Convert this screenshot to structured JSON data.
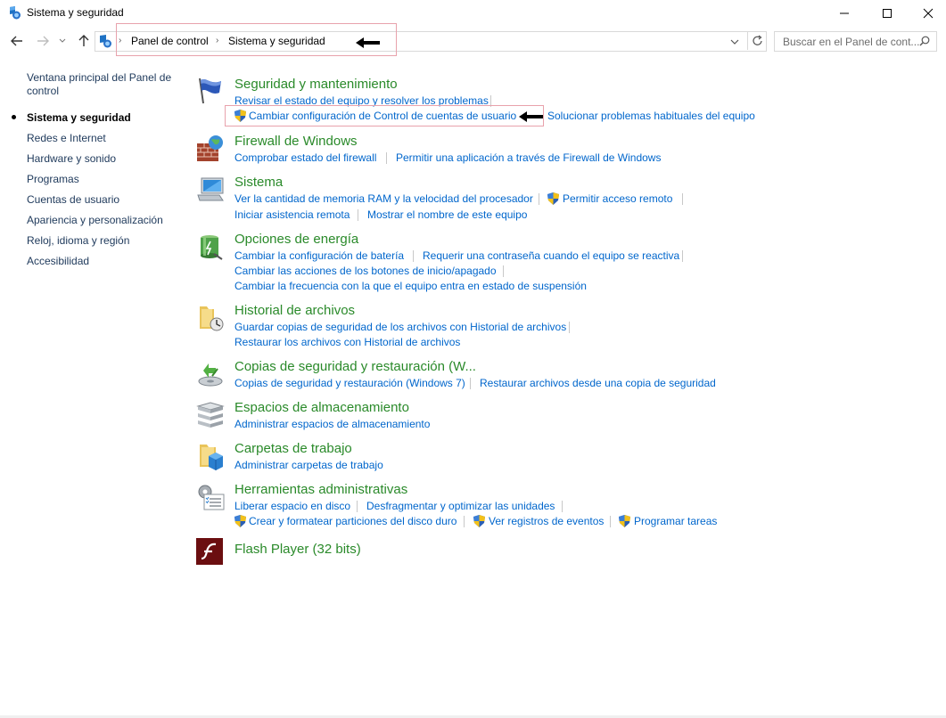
{
  "window": {
    "title": "Sistema y seguridad"
  },
  "nav": {
    "breadcrumb_root": "Panel de control",
    "breadcrumb_current": "Sistema y seguridad",
    "search_placeholder": "Buscar en el Panel de cont..."
  },
  "sidebar": {
    "home_line1": "Ventana principal del Panel de",
    "home_line2": "control",
    "items": [
      {
        "label": "Sistema y seguridad"
      },
      {
        "label": "Redes e Internet"
      },
      {
        "label": "Hardware y sonido"
      },
      {
        "label": "Programas"
      },
      {
        "label": "Cuentas de usuario"
      },
      {
        "label": "Apariencia y personalización"
      },
      {
        "label": "Reloj, idioma y región"
      },
      {
        "label": "Accesibilidad"
      }
    ]
  },
  "categories": {
    "seguridad": {
      "title": "Seguridad y mantenimiento",
      "links": [
        "Revisar el estado del equipo y resolver los problemas",
        "Cambiar configuración de Control de cuentas de usuario",
        "Solucionar problemas habituales del equipo"
      ]
    },
    "firewall": {
      "title": "Firewall de Windows",
      "links": [
        "Comprobar estado del firewall",
        "Permitir una aplicación a través de Firewall de Windows"
      ]
    },
    "sistema": {
      "title": "Sistema",
      "links": [
        "Ver la cantidad de memoria RAM y la velocidad del procesador",
        "Permitir acceso remoto",
        "Iniciar asistencia remota",
        "Mostrar el nombre de este equipo"
      ]
    },
    "energia": {
      "title": "Opciones de energía",
      "links": [
        "Cambiar la configuración de batería",
        "Requerir una contraseña cuando el equipo se reactiva",
        "Cambiar las acciones de los botones de inicio/apagado",
        "Cambiar la frecuencia con la que el equipo entra en estado de suspensión"
      ]
    },
    "historial": {
      "title": "Historial de archivos",
      "links": [
        "Guardar copias de seguridad de los archivos con Historial de archivos",
        "Restaurar los archivos con Historial de archivos"
      ]
    },
    "copias": {
      "title": "Copias de seguridad y restauración (W...",
      "links": [
        "Copias de seguridad y restauración (Windows 7)",
        "Restaurar archivos desde una copia de seguridad"
      ]
    },
    "espacios": {
      "title": "Espacios de almacenamiento",
      "links": [
        "Administrar espacios de almacenamiento"
      ]
    },
    "carpetas": {
      "title": "Carpetas de trabajo",
      "links": [
        "Administrar carpetas de trabajo"
      ]
    },
    "herramientas": {
      "title": "Herramientas administrativas",
      "links": [
        "Liberar espacio en disco",
        "Desfragmentar y optimizar las unidades",
        "Crear y formatear particiones del disco duro",
        "Ver registros de eventos",
        "Programar tareas"
      ]
    },
    "flash": {
      "title": "Flash Player (32 bits)"
    }
  },
  "colors": {
    "heading": "#2a8a2a",
    "link": "#0066cc",
    "annotation_box": "#e8a2ac"
  }
}
